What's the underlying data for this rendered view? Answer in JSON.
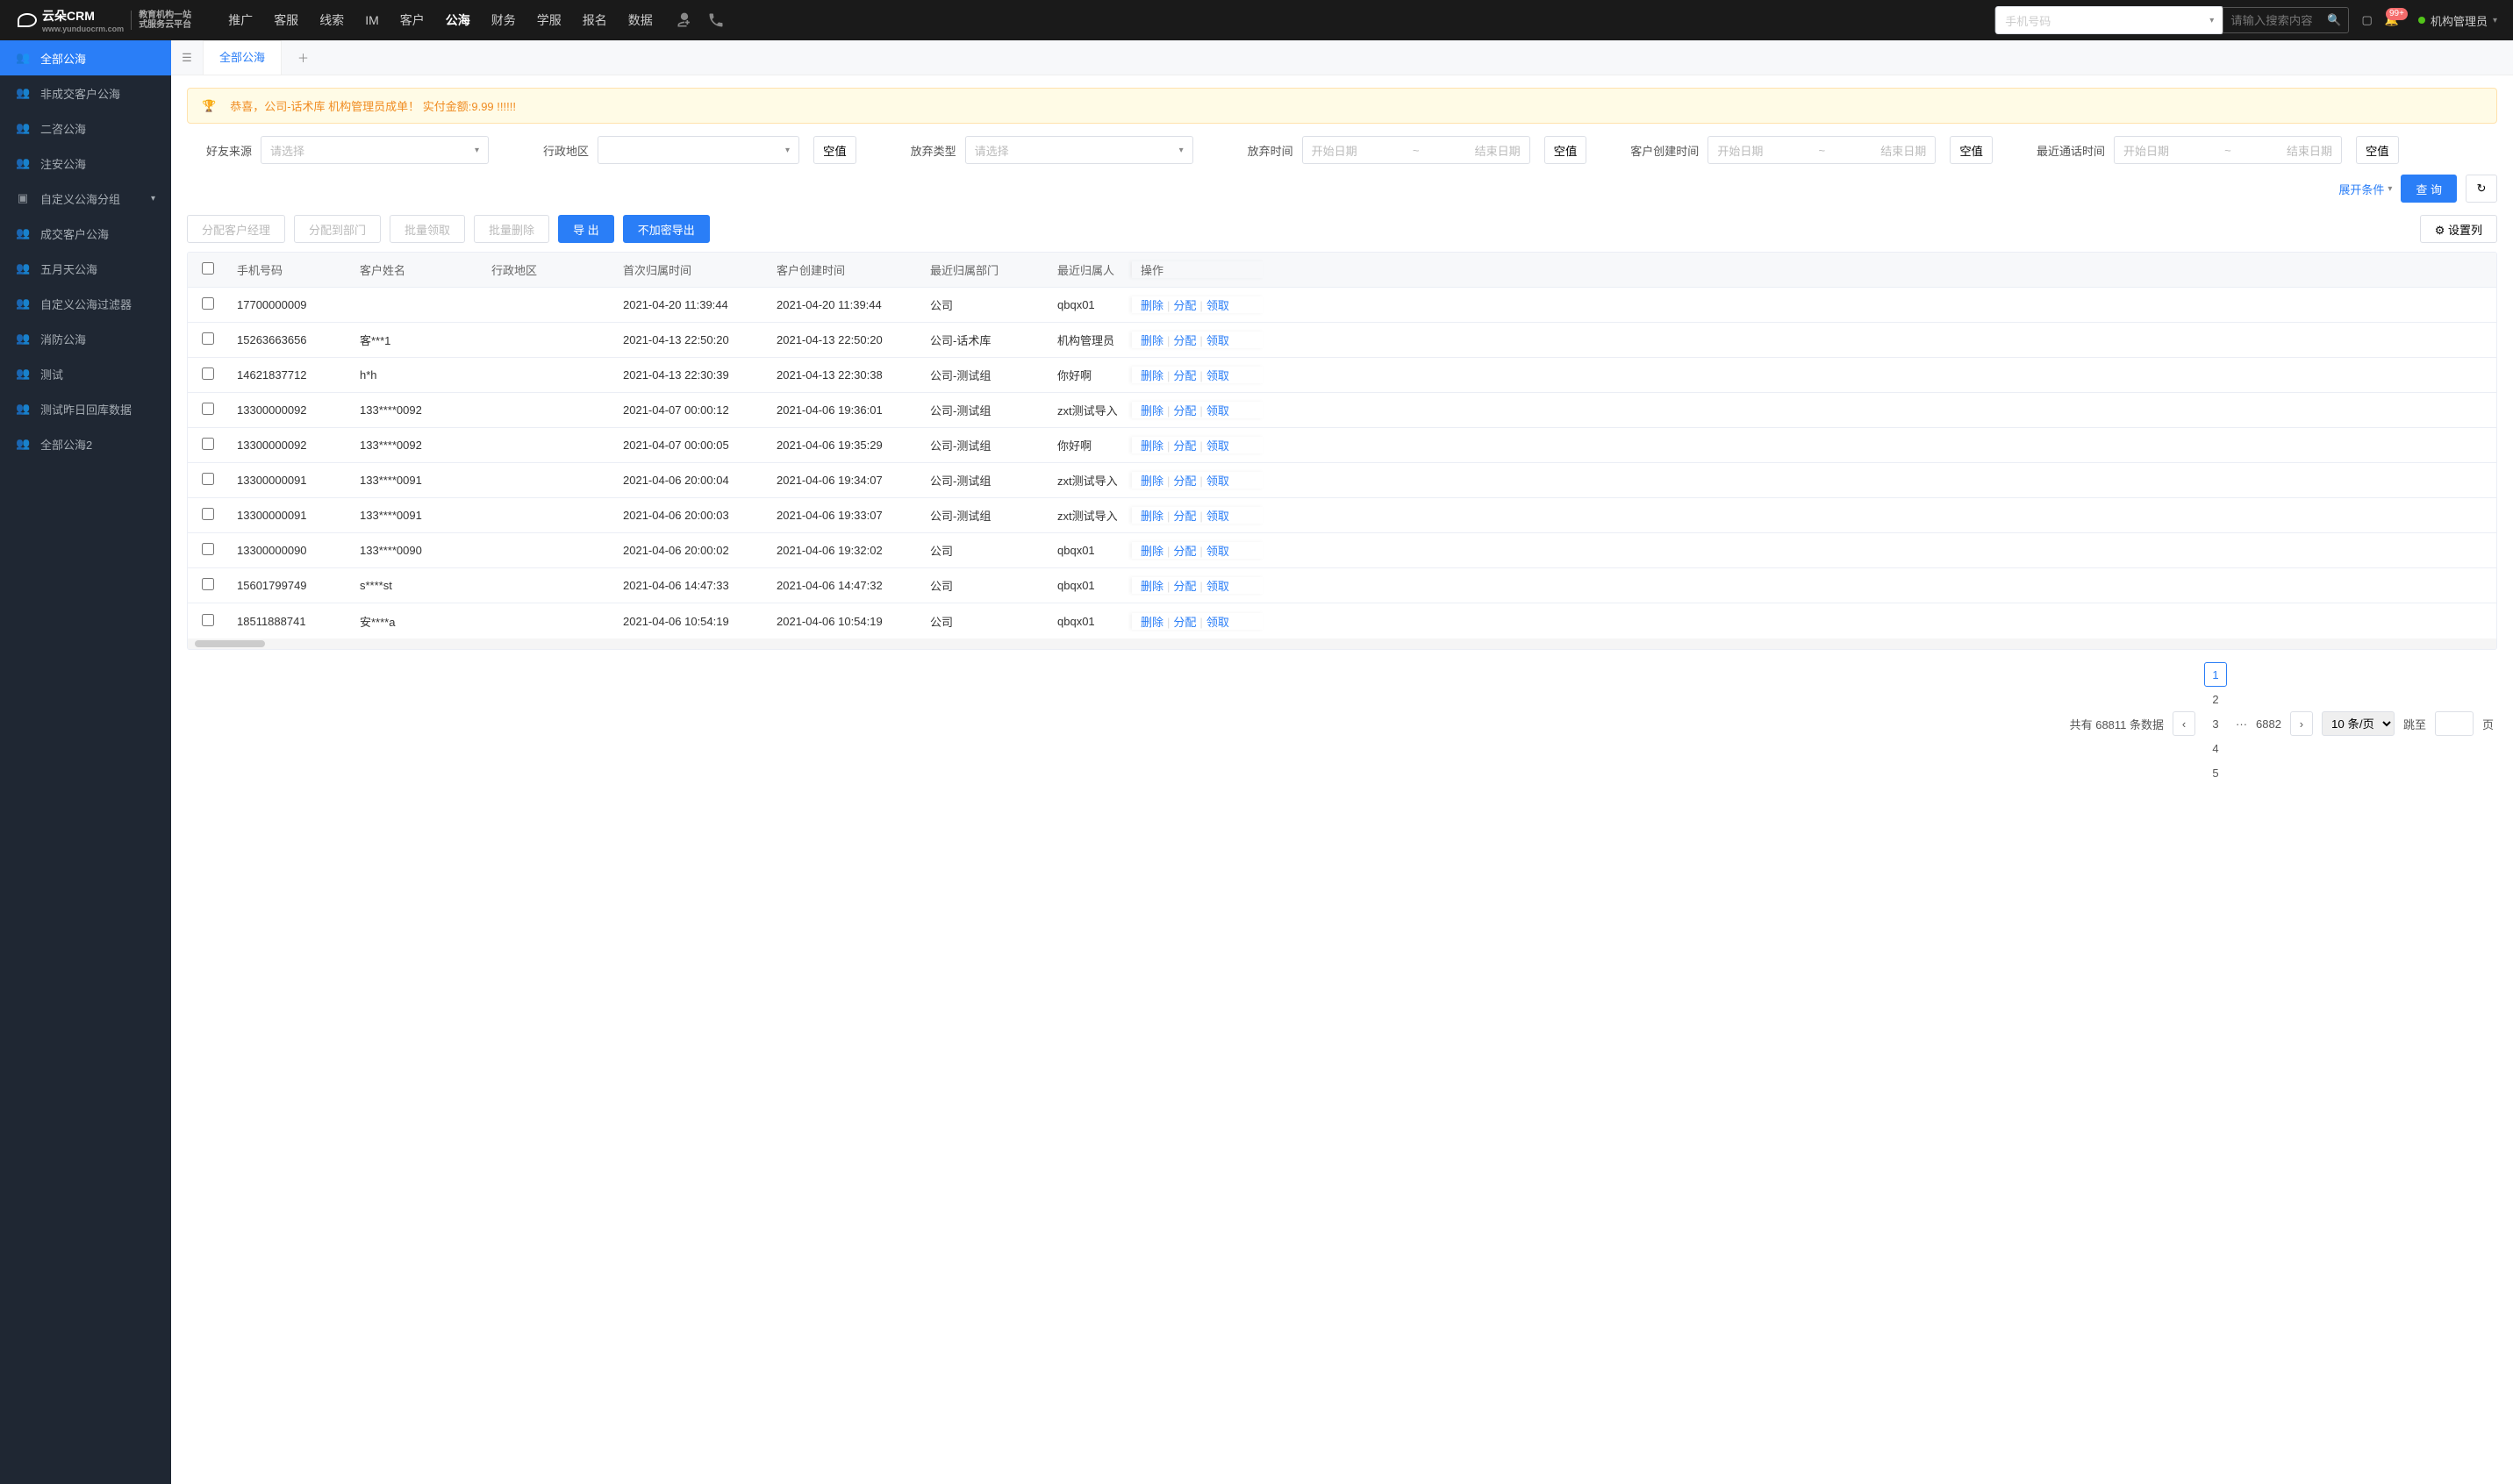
{
  "logo": {
    "brand": "云朵CRM",
    "url": "www.yunduocrm.com",
    "sub1": "教育机构一站",
    "sub2": "式服务云平台"
  },
  "topnav": {
    "items": [
      "推广",
      "客服",
      "线索",
      "IM",
      "客户",
      "公海",
      "财务",
      "学服",
      "报名",
      "数据"
    ],
    "active": 5,
    "search_type": "手机号码",
    "search_placeholder": "请输入搜索内容",
    "badge": "99+",
    "user": "机构管理员"
  },
  "sidebar": {
    "items": [
      {
        "label": "全部公海",
        "icon": "👥"
      },
      {
        "label": "非成交客户公海",
        "icon": "👥"
      },
      {
        "label": "二咨公海",
        "icon": "👥"
      },
      {
        "label": "注安公海",
        "icon": "👥"
      },
      {
        "label": "自定义公海分组",
        "icon": "▣",
        "expandable": true
      },
      {
        "label": "成交客户公海",
        "icon": "👥"
      },
      {
        "label": "五月天公海",
        "icon": "👥"
      },
      {
        "label": "自定义公海过滤器",
        "icon": "👥"
      },
      {
        "label": "消防公海",
        "icon": "👥"
      },
      {
        "label": "测试",
        "icon": "👥"
      },
      {
        "label": "测试昨日回库数据",
        "icon": "👥"
      },
      {
        "label": "全部公海2",
        "icon": "👥"
      }
    ],
    "active": 0
  },
  "tab": {
    "label": "全部公海"
  },
  "alert": {
    "msg": "恭喜，公司-话术库  机构管理员成单！  实付金额:9.99 !!!!!!"
  },
  "filters": {
    "friend_source": {
      "label": "好友来源",
      "ph": "请选择"
    },
    "region": {
      "label": "行政地区",
      "empty": "空值"
    },
    "abandon_type": {
      "label": "放弃类型",
      "ph": "请选择"
    },
    "abandon_time": {
      "label": "放弃时间",
      "start": "开始日期",
      "end": "结束日期",
      "empty": "空值"
    },
    "create_time": {
      "label": "客户创建时间",
      "start": "开始日期",
      "end": "结束日期",
      "empty": "空值"
    },
    "call_time": {
      "label": "最近通话时间",
      "start": "开始日期",
      "end": "结束日期",
      "empty": "空值"
    },
    "expand": "展开条件",
    "query": "查 询"
  },
  "toolbar": {
    "assign_mgr": "分配客户经理",
    "assign_dept": "分配到部门",
    "batch_claim": "批量领取",
    "batch_delete": "批量删除",
    "export": "导 出",
    "export_plain": "不加密导出",
    "set_cols": "设置列"
  },
  "table": {
    "cols": [
      "手机号码",
      "客户姓名",
      "行政地区",
      "首次归属时间",
      "客户创建时间",
      "最近归属部门",
      "最近归属人",
      "操作"
    ],
    "ops": {
      "delete": "删除",
      "assign": "分配",
      "claim": "领取"
    },
    "rows": [
      {
        "phone": "17700000009",
        "name": "",
        "area": "",
        "t1": "2021-04-20 11:39:44",
        "t2": "2021-04-20 11:39:44",
        "dept": "公司",
        "owner": "qbqx01"
      },
      {
        "phone": "15263663656",
        "name": "客***1",
        "area": "",
        "t1": "2021-04-13 22:50:20",
        "t2": "2021-04-13 22:50:20",
        "dept": "公司-话术库",
        "owner": "机构管理员"
      },
      {
        "phone": "14621837712",
        "name": "h*h",
        "area": "",
        "t1": "2021-04-13 22:30:39",
        "t2": "2021-04-13 22:30:38",
        "dept": "公司-测试组",
        "owner": "你好啊"
      },
      {
        "phone": "13300000092",
        "name": "133****0092",
        "area": "",
        "t1": "2021-04-07 00:00:12",
        "t2": "2021-04-06 19:36:01",
        "dept": "公司-测试组",
        "owner": "zxt测试导入"
      },
      {
        "phone": "13300000092",
        "name": "133****0092",
        "area": "",
        "t1": "2021-04-07 00:00:05",
        "t2": "2021-04-06 19:35:29",
        "dept": "公司-测试组",
        "owner": "你好啊"
      },
      {
        "phone": "13300000091",
        "name": "133****0091",
        "area": "",
        "t1": "2021-04-06 20:00:04",
        "t2": "2021-04-06 19:34:07",
        "dept": "公司-测试组",
        "owner": "zxt测试导入"
      },
      {
        "phone": "13300000091",
        "name": "133****0091",
        "area": "",
        "t1": "2021-04-06 20:00:03",
        "t2": "2021-04-06 19:33:07",
        "dept": "公司-测试组",
        "owner": "zxt测试导入"
      },
      {
        "phone": "13300000090",
        "name": "133****0090",
        "area": "",
        "t1": "2021-04-06 20:00:02",
        "t2": "2021-04-06 19:32:02",
        "dept": "公司",
        "owner": "qbqx01"
      },
      {
        "phone": "15601799749",
        "name": "s****st",
        "area": "",
        "t1": "2021-04-06 14:47:33",
        "t2": "2021-04-06 14:47:32",
        "dept": "公司",
        "owner": "qbqx01"
      },
      {
        "phone": "18511888741",
        "name": "安****a",
        "area": "",
        "t1": "2021-04-06 10:54:19",
        "t2": "2021-04-06 10:54:19",
        "dept": "公司",
        "owner": "qbqx01"
      }
    ]
  },
  "pager": {
    "total_pre": "共有",
    "total": "68811",
    "total_suf": "条数据",
    "pages": [
      "1",
      "2",
      "3",
      "4",
      "5"
    ],
    "last": "6882",
    "per": "10 条/页",
    "jump_pre": "跳至",
    "jump_suf": "页"
  }
}
